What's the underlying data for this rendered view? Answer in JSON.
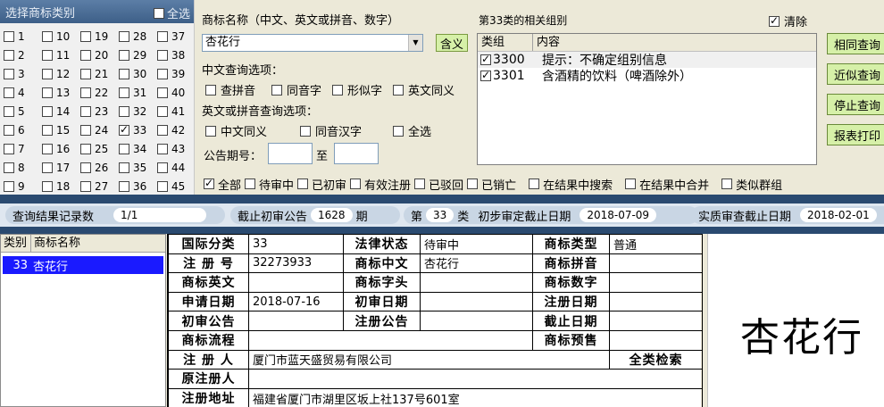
{
  "class_panel": {
    "title": "选择商标类别",
    "select_all": "全选",
    "classes": [
      "1",
      "10",
      "19",
      "28",
      "37",
      "2",
      "11",
      "20",
      "29",
      "38",
      "3",
      "12",
      "21",
      "30",
      "39",
      "4",
      "13",
      "22",
      "31",
      "40",
      "5",
      "14",
      "23",
      "32",
      "41",
      "6",
      "15",
      "24",
      "33",
      "42",
      "7",
      "16",
      "25",
      "34",
      "43",
      "8",
      "17",
      "26",
      "35",
      "44",
      "9",
      "18",
      "27",
      "36",
      "45"
    ],
    "checked": [
      "33"
    ]
  },
  "query": {
    "name_label": "商标名称（中文、英文或拼音、数字）",
    "name_value": "杏花行",
    "meaning_button": "含义",
    "cn_options_label": "中文查询选项：",
    "cn_options": [
      "查拼音",
      "同音字",
      "形似字",
      "英文同义"
    ],
    "en_options_label": "英文或拼音查询选项：",
    "en_options": [
      "中文同义",
      "同音汉字",
      "全选"
    ],
    "notice_label": "公告期号：",
    "notice_to": "至"
  },
  "groups": {
    "title": "第33类的相关组别",
    "clear_label": "清除",
    "headers": [
      "类组",
      "内容"
    ],
    "rows": [
      {
        "code": "3300",
        "content": "提示：不确定组别信息"
      },
      {
        "code": "3301",
        "content": "含酒精的饮料（啤酒除外）"
      }
    ]
  },
  "side_buttons": [
    "相同查询",
    "近似查询",
    "停止查询",
    "报表打印"
  ],
  "filters": [
    {
      "label": "全部",
      "checked": true
    },
    {
      "label": "待审中",
      "checked": false
    },
    {
      "label": "已初审",
      "checked": false
    },
    {
      "label": "有效注册",
      "checked": false
    },
    {
      "label": "已驳回",
      "checked": false
    },
    {
      "label": "已销亡",
      "checked": false
    },
    {
      "label": "在结果中搜索",
      "checked": false
    },
    {
      "label": "在结果中合并",
      "checked": false
    },
    {
      "label": "类似群组",
      "checked": false
    }
  ],
  "status": {
    "count_label": "查询结果记录数",
    "count_value": "1/1",
    "cutoff_label": "截止初审公告",
    "cutoff_value": "1628",
    "cutoff_unit": "期",
    "class_prefix": "第",
    "class_value": "33",
    "class_suffix": "类",
    "prelim_label": "初步审定截止日期",
    "prelim_value": "2018-07-09",
    "actual_label": "实质审查截止日期",
    "actual_value": "2018-02-01"
  },
  "results": {
    "headers": [
      "类别",
      "商标名称"
    ],
    "row": {
      "class": "33",
      "name": "杏花行"
    }
  },
  "detail": {
    "intl_class_label": "国际分类",
    "intl_class": "33",
    "legal_status_label": "法律状态",
    "legal_status": "待审中",
    "type_label": "商标类型",
    "type": "普通",
    "reg_no_label": "注 册 号",
    "reg_no": "32273933",
    "cn_label": "商标中文",
    "cn": "杏花行",
    "pinyin_label": "商标拼音",
    "en_label": "商标英文",
    "initial_label": "商标字头",
    "digit_label": "商标数字",
    "apply_date_label": "申请日期",
    "apply_date": "2018-07-16",
    "prelim_date_label": "初审日期",
    "reg_date_label": "注册日期",
    "prelim_notice_label": "初审公告",
    "reg_notice_label": "注册公告",
    "end_date_label": "截止日期",
    "flow_label": "商标流程",
    "preview_label": "商标预售",
    "registrant_label": "注 册 人",
    "registrant": "厦门市蓝天盛贸易有限公司",
    "all_class_search": "全类检索",
    "orig_registrant_label": "原注册人",
    "address_label": "注册地址",
    "address": "福建省厦门市湖里区坂上社137号601室"
  },
  "preview": {
    "text": "杏花行"
  }
}
